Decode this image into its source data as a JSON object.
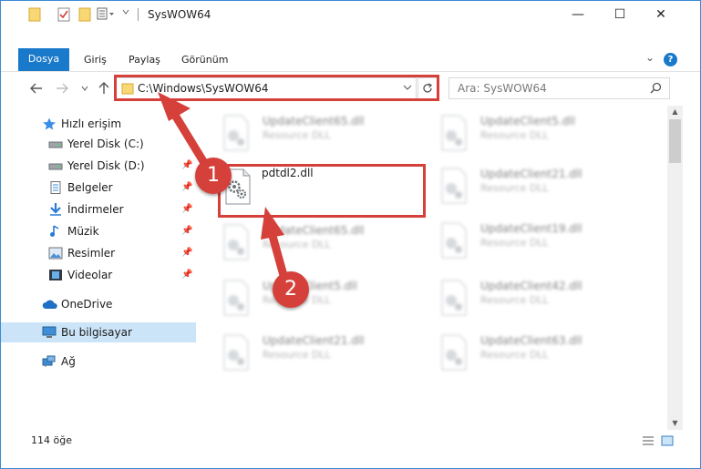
{
  "window": {
    "title": "SysWOW64",
    "controls": {
      "minimize": "—",
      "maximize": "☐",
      "close": "✕"
    }
  },
  "ribbon": {
    "tabs": [
      "Dosya",
      "Giriş",
      "Paylaş",
      "Görünüm"
    ],
    "expand_chevron": "⌄",
    "help": "?"
  },
  "address_bar": {
    "path": "C:\\Windows\\SysWOW64",
    "search_placeholder": "Ara: SysWOW64"
  },
  "nav_pane": {
    "items": [
      {
        "label": "Hızlı erişim",
        "icon": "star-icon",
        "pinned": false
      },
      {
        "label": "Yerel Disk (C:)",
        "icon": "drive-icon",
        "pinned": false
      },
      {
        "label": "Yerel Disk (D:)",
        "icon": "drive-icon",
        "pinned": true
      },
      {
        "label": "Belgeler",
        "icon": "documents-icon",
        "pinned": true
      },
      {
        "label": "İndirmeler",
        "icon": "download-icon",
        "pinned": true
      },
      {
        "label": "Müzik",
        "icon": "music-icon",
        "pinned": true
      },
      {
        "label": "Resimler",
        "icon": "pictures-icon",
        "pinned": true
      },
      {
        "label": "Videolar",
        "icon": "video-icon",
        "pinned": true
      },
      {
        "label": "OneDrive",
        "icon": "cloud-icon",
        "pinned": false
      },
      {
        "label": "Bu bilgisayar",
        "icon": "computer-icon",
        "pinned": false,
        "selected": true
      },
      {
        "label": "Ağ",
        "icon": "network-icon",
        "pinned": false
      }
    ]
  },
  "files": {
    "highlighted": {
      "name": "pdtdl2.dll"
    },
    "left_column": [
      {
        "name": "UpdateClient65.dll",
        "type": "Resource DLL"
      },
      {
        "name": "UpdateClient65.dll",
        "type": "Resource DLL"
      },
      {
        "name": "UpdateClient5.dll",
        "type": "Resource DLL"
      },
      {
        "name": "UpdateClient21.dll",
        "type": "Resource DLL"
      }
    ],
    "right_column": [
      {
        "name": "UpdateClient5.dll",
        "type": "Resource DLL"
      },
      {
        "name": "UpdateClient21.dll",
        "type": "Resource DLL"
      },
      {
        "name": "UpdateClient19.dll",
        "type": "Resource DLL"
      },
      {
        "name": "UpdateClient42.dll",
        "type": "Resource DLL"
      },
      {
        "name": "UpdateClient63.dll",
        "type": "Resource DLL"
      }
    ]
  },
  "status": {
    "item_count": "114 öğe"
  },
  "annotations": {
    "step1": "1",
    "step2": "2"
  },
  "colors": {
    "accent": "#1979ca",
    "highlight": "#d6403a",
    "selected": "#cce4f7"
  }
}
